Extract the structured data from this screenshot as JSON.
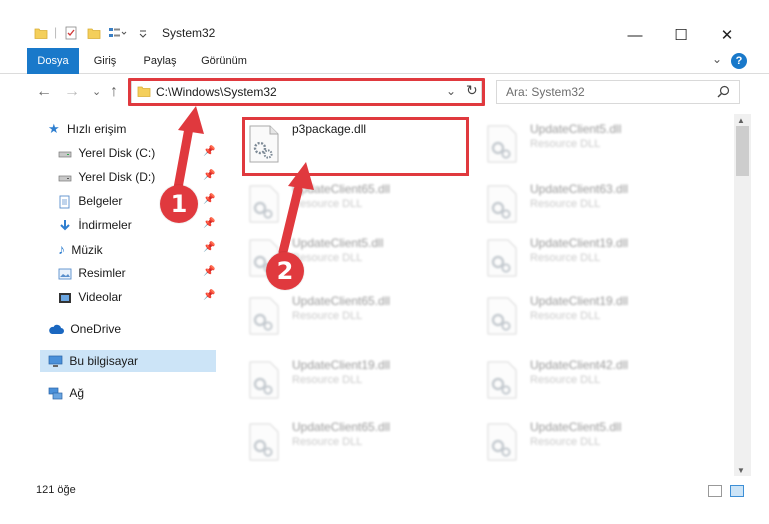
{
  "window": {
    "title": "System32",
    "minimize_glyph": "—",
    "maximize_glyph": "☐",
    "close_glyph": "✕"
  },
  "ribbon": {
    "tabs": [
      {
        "label": "Dosya",
        "active": true
      },
      {
        "label": "Giriş",
        "active": false
      },
      {
        "label": "Paylaş",
        "active": false
      },
      {
        "label": "Görünüm",
        "active": false
      }
    ],
    "expand_glyph": "⌄",
    "help_glyph": "?"
  },
  "navigation": {
    "back_glyph": "←",
    "forward_glyph": "→",
    "recent_glyph": "⌄",
    "up_glyph": "↑",
    "address": "C:\\Windows\\System32",
    "dropdown_glyph": "⌄",
    "refresh_glyph": "↻",
    "search_placeholder": "Ara: System32"
  },
  "sidebar": {
    "items": [
      {
        "label": "Hızlı erişim",
        "icon": "star-icon",
        "pinned": false
      },
      {
        "label": "Yerel Disk (C:)",
        "icon": "drive-icon",
        "pinned": true
      },
      {
        "label": "Yerel Disk (D:)",
        "icon": "drive-icon",
        "pinned": true
      },
      {
        "label": "Belgeler",
        "icon": "documents-icon",
        "pinned": true
      },
      {
        "label": "İndirmeler",
        "icon": "download-icon",
        "pinned": true
      },
      {
        "label": "Müzik",
        "icon": "music-icon",
        "pinned": true
      },
      {
        "label": "Resimler",
        "icon": "pictures-icon",
        "pinned": true
      },
      {
        "label": "Videolar",
        "icon": "video-icon",
        "pinned": true
      },
      {
        "label": "OneDrive",
        "icon": "cloud-icon",
        "pinned": false
      },
      {
        "label": "Bu bilgisayar",
        "icon": "computer-icon",
        "pinned": false,
        "selected": true
      },
      {
        "label": "Ağ",
        "icon": "network-icon",
        "pinned": false
      }
    ],
    "pin_glyph": "📌"
  },
  "files": [
    {
      "name": "p3package.dll",
      "type": "",
      "focused": true
    },
    {
      "name": "UpdateClient5.dll",
      "type": "Resource DLL"
    },
    {
      "name": "UpdateClient65.dll",
      "type": "Resource DLL"
    },
    {
      "name": "UpdateClient63.dll",
      "type": "Resource DLL"
    },
    {
      "name": "UpdateClient5.dll",
      "type": "Resource DLL"
    },
    {
      "name": "UpdateClient19.dll",
      "type": "Resource DLL"
    },
    {
      "name": "UpdateClient65.dll",
      "type": "Resource DLL"
    },
    {
      "name": "UpdateClient19.dll",
      "type": "Resource DLL"
    },
    {
      "name": "UpdateClient19.dll",
      "type": "Resource DLL"
    },
    {
      "name": "UpdateClient42.dll",
      "type": "Resource DLL"
    },
    {
      "name": "UpdateClient65.dll",
      "type": "Resource DLL"
    },
    {
      "name": "UpdateClient5.dll",
      "type": "Resource DLL"
    }
  ],
  "status": {
    "count_text": "121 öğe"
  },
  "annotations": {
    "step1": "1",
    "step2": "2"
  },
  "colors": {
    "accent": "#1979ca",
    "highlight": "#e0393e",
    "selection": "#cce4f7"
  }
}
